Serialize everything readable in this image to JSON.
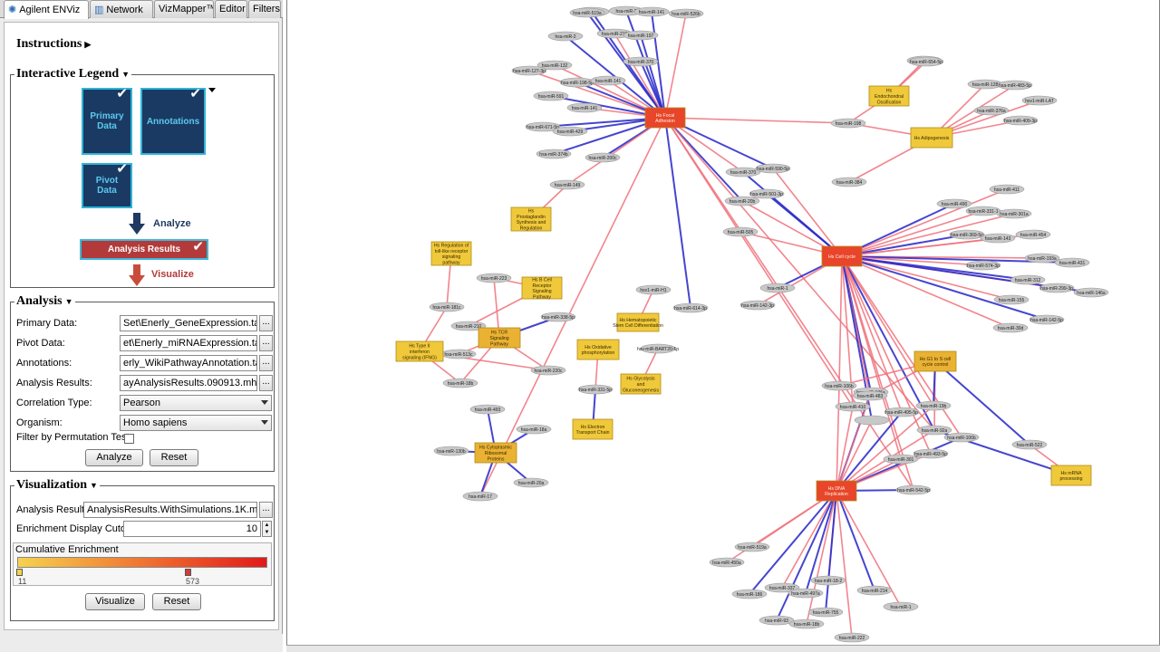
{
  "tabs": [
    {
      "label": "Agilent ENViz",
      "icon": "agilent-spark-icon",
      "active": true
    },
    {
      "label": "Network",
      "icon": "network-icon",
      "active": false
    },
    {
      "label": "VizMapper™",
      "active": false
    },
    {
      "label": "Editor",
      "active": false
    },
    {
      "label": "Filters",
      "active": false
    }
  ],
  "instructions": {
    "title": "Instructions"
  },
  "legend": {
    "title": "Interactive Legend",
    "primary": "Primary Data",
    "annotations": "Annotations",
    "pivot": "Pivot Data",
    "analyze": "Analyze",
    "results": "Analysis Results",
    "visualize": "Visualize"
  },
  "analysis": {
    "title": "Analysis",
    "primary_label": "Primary Data:",
    "primary_value": "Set\\Enerly_GeneExpression.tab",
    "pivot_label": "Pivot Data:",
    "pivot_value": "et\\Enerly_miRNAExpression.tab",
    "annotations_label": "Annotations:",
    "annotations_value": "erly_WikiPathwayAnnotation.tab",
    "results_label": "Analysis Results:",
    "results_value": "ayAnalysisResults.090913.mhg",
    "correlation_label": "Correlation Type:",
    "correlation_value": "Pearson",
    "organism_label": "Organism:",
    "organism_value": "Homo sapiens",
    "permutation_label": "Filter by Permutation Test:",
    "browse": "...",
    "analyze_button": "Analyze",
    "reset_button": "Reset"
  },
  "visualization": {
    "title": "Visualization",
    "results_label": "Analysis Results:",
    "results_value": "AnalysisResults.WithSimulations.1K.mhg",
    "cutoff_label": "Enrichment Display Cutoff:",
    "cutoff_value": "10",
    "enrichment_title": "Cumulative Enrichment",
    "min_value": "11",
    "max_value": "573",
    "visualize_button": "Visualize",
    "reset_button": "Reset",
    "browse": "..."
  },
  "colors": {
    "hub": "#e8452a",
    "pathway": "#f0c93b",
    "mirna": "#c8c8c8",
    "edge_positive": "#f0707a",
    "edge_negative": "#2525c8",
    "legend_dark": "#1a3a63",
    "legend_border": "#2fb4d7",
    "results_red": "#b23a3a"
  },
  "network": {
    "hubs": [
      {
        "id": "fa",
        "lines": [
          "Hs Focal",
          "Adhesion"
        ]
      },
      {
        "id": "cc",
        "lines": [
          "Hs Cell cycle"
        ]
      },
      {
        "id": "dna",
        "lines": [
          "Hs DNA",
          "Replication"
        ]
      }
    ],
    "pathways": [
      {
        "id": "endo",
        "lines": [
          "Hs",
          "Endochondral",
          "Ossification"
        ]
      },
      {
        "id": "adipo",
        "lines": [
          "Hs Adipogenesis"
        ]
      },
      {
        "id": "prost",
        "lines": [
          "Hs",
          "Prostaglandin",
          "Synthesis and",
          "Regulation"
        ]
      },
      {
        "id": "tollreg",
        "lines": [
          "Hs Regulation of",
          "toll-like receptor",
          "signaling",
          "pathway"
        ]
      },
      {
        "id": "bcell",
        "lines": [
          "Hs B Cell",
          "Receptor",
          "Signaling",
          "Pathway"
        ]
      },
      {
        "id": "tcr",
        "lines": [
          "Hs TCR",
          "Signaling",
          "Pathway"
        ]
      },
      {
        "id": "ifng",
        "lines": [
          "Hs Type II",
          "interferon",
          "signaling (IFNG)"
        ]
      },
      {
        "id": "hemato",
        "lines": [
          "Hs Hematopoietic",
          "Stem Cell Differentiation"
        ]
      },
      {
        "id": "oxphos",
        "lines": [
          "Hs Oxidative",
          "phosphorylation"
        ]
      },
      {
        "id": "glyco",
        "lines": [
          "Hs Glycolysis",
          "and",
          "Gluconeogenesis"
        ]
      },
      {
        "id": "etc",
        "lines": [
          "Hs Electron",
          "Transport Chain"
        ]
      },
      {
        "id": "ribo",
        "lines": [
          "Hs Cytoplasmic",
          "Ribosomal",
          "Proteins"
        ]
      },
      {
        "id": "g1s",
        "lines": [
          "Hs G1 to S cell",
          "cycle control"
        ]
      },
      {
        "id": "mrna",
        "lines": [
          "Hs mRNA",
          "processing"
        ]
      }
    ],
    "mirna_labels": [
      "hsa-miR-4",
      "hsa-miR-519a",
      "hsa-miR-2",
      "hsa-miR-141",
      "hsa-miR-526b",
      "hsa-miR-2",
      "hsa-miR-218",
      "hsa-miR-197",
      "hsa-miR-132",
      "hsa-miR-370",
      "hsa-miR-127-3p",
      "hsa-miR-198-5p",
      "hsa-miR-141",
      "hsa-miR-591",
      "hsa-miR-141",
      "hsa-miR-671-5p",
      "hsa-miR-429",
      "hsa-miR-374b",
      "hsa-miR-200c",
      "hsa-miR-149",
      "hsa-miR-340",
      "hsa-miR-654-5p",
      "hsa-miR-198",
      "hsa-miR-384",
      "hsa-miR-128",
      "hsa-miR-483-5p",
      "hsv1-miR-LAT",
      "hsa-miR-376a",
      "hsa-miR-409-3p",
      "hsa-miR-370",
      "hsa-miR-590-5p",
      "hsa-miR-20b",
      "hsa-miR-501-3p",
      "hsa-miR-505",
      "hsa-miR-411",
      "hsa-miR-490",
      "hsa-miR-331-1",
      "hsa-miR-301a",
      "hsa-miR-369-5p",
      "hsa-miR-143",
      "hsa-miR-454",
      "hsa-miR-193a",
      "hsa-miR-431",
      "hsa-miR-574-3p",
      "hsa-miR-312",
      "hsa-miR-299-3p",
      "hsa-miR-146a",
      "hsa-miR-155",
      "hsa-miR-1",
      "hsa-miR-142-3p",
      "hsa-miR-142-5p",
      "hsa-miR-30d",
      "hsa-miR-223",
      "hsa-miR-181c",
      "hsa-miR-210",
      "hsa-miR-513c",
      "hsa-miR-18b",
      "hsa-miR-338-5p",
      "hsa-miR-220c",
      "hsv1-miR-H1",
      "hsv-miR-BART20-5p",
      "hsa-miR-331-5p",
      "hsa-miR-614-3p",
      "hsa-miR-493",
      "hsa-miR-18a",
      "hsa-miR-130b",
      "hsa-miR-20a",
      "hsa-miR-17",
      "hsa-miR-106b",
      "hsa-miR-106a",
      "hsa-miR-410",
      "hsa-miR-495-5p",
      "hsa-miR-19b",
      "hsa-miR-92a",
      "hsa-miR-106b",
      "hsa-miR-493-5p",
      "hsa-miR-301",
      "hsa-miR-522",
      "hsa-miR-542-5p",
      "hsa-miR-519a",
      "hsa-miR-450a",
      "hsa-miR-186",
      "hsa-miR-337",
      "hsa-miR-497a",
      "hsa-miR-18-2",
      "hsa-miR-214",
      "hsa-miR-1",
      "hsa-miR-93",
      "hsa-miR-18b",
      "hsa-miR-755",
      "hsa-miR-222",
      "hsa-miR-483"
    ]
  }
}
